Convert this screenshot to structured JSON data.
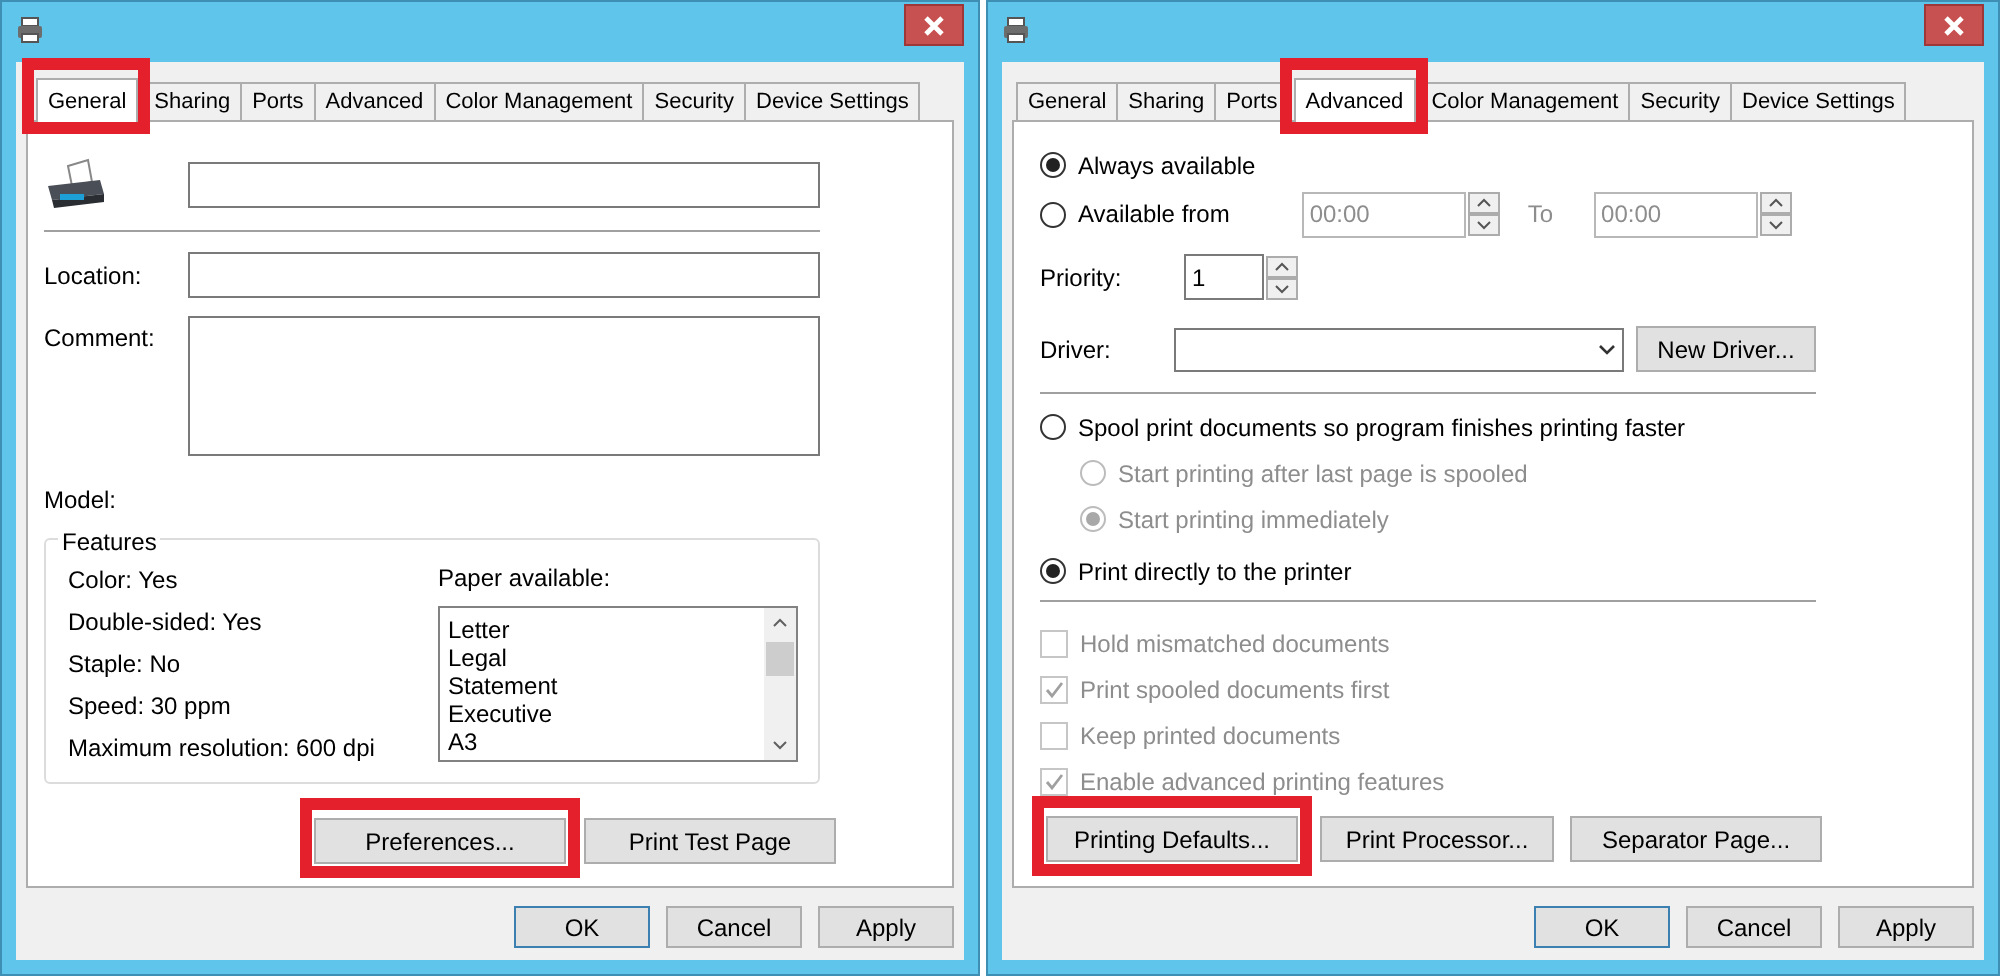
{
  "general_dialog": {
    "tabs": [
      {
        "label": "General",
        "selected": true,
        "highlighted": true
      },
      {
        "label": "Sharing",
        "selected": false,
        "highlighted": false
      },
      {
        "label": "Ports",
        "selected": false,
        "highlighted": false
      },
      {
        "label": "Advanced",
        "selected": false,
        "highlighted": false
      },
      {
        "label": "Color Management",
        "selected": false,
        "highlighted": false
      },
      {
        "label": "Security",
        "selected": false,
        "highlighted": false
      },
      {
        "label": "Device Settings",
        "selected": false,
        "highlighted": false
      }
    ],
    "location_label": "Location:",
    "comment_label": "Comment:",
    "model_label": "Model:",
    "features": {
      "title": "Features",
      "items": [
        "Color: Yes",
        "Double-sided: Yes",
        "Staple: No",
        "Speed: 30 ppm",
        "Maximum resolution: 600 dpi"
      ],
      "paper_label": "Paper available:",
      "paper": [
        "Letter",
        "Legal",
        "Statement",
        "Executive",
        "A3"
      ]
    },
    "buttons": [
      {
        "label": "Preferences...",
        "highlighted": true
      },
      {
        "label": "Print Test Page",
        "highlighted": false
      }
    ],
    "footer_buttons": [
      {
        "label": "OK",
        "default": true
      },
      {
        "label": "Cancel",
        "default": false
      },
      {
        "label": "Apply",
        "default": false
      }
    ]
  },
  "advanced_dialog": {
    "tabs": [
      {
        "label": "General",
        "selected": false,
        "highlighted": false
      },
      {
        "label": "Sharing",
        "selected": false,
        "highlighted": false
      },
      {
        "label": "Ports",
        "selected": false,
        "highlighted": false
      },
      {
        "label": "Advanced",
        "selected": true,
        "highlighted": true
      },
      {
        "label": "Color Management",
        "selected": false,
        "highlighted": false
      },
      {
        "label": "Security",
        "selected": false,
        "highlighted": false
      },
      {
        "label": "Device Settings",
        "selected": false,
        "highlighted": false
      }
    ],
    "availability": [
      {
        "label": "Always available",
        "selected": true
      },
      {
        "label": "Available from",
        "selected": false
      }
    ],
    "from_time": {
      "value": "00:00",
      "disabled": true
    },
    "to_label": "To",
    "to_time": {
      "value": "00:00",
      "disabled": true
    },
    "priority_label": "Priority:",
    "priority": "1",
    "driver_label": "Driver:",
    "new_driver_button": "New Driver...",
    "spool_options": [
      {
        "label": "Spool print documents so program finishes printing faster",
        "selected": false,
        "children": [
          {
            "label": "Start printing after last page is spooled",
            "selected": false,
            "disabled": true
          },
          {
            "label": "Start printing immediately",
            "selected": true,
            "disabled": true
          }
        ]
      },
      {
        "label": "Print directly to the printer",
        "selected": true
      }
    ],
    "checkboxes": [
      {
        "label": "Hold mismatched documents",
        "checked": false,
        "disabled": true
      },
      {
        "label": "Print spooled documents first",
        "checked": true,
        "disabled": true
      },
      {
        "label": "Keep printed documents",
        "checked": false,
        "disabled": true
      },
      {
        "label": "Enable advanced printing features",
        "checked": true,
        "disabled": true
      }
    ],
    "buttons": [
      {
        "label": "Printing Defaults...",
        "highlighted": true
      },
      {
        "label": "Print Processor...",
        "highlighted": false
      },
      {
        "label": "Separator Page...",
        "highlighted": false
      }
    ],
    "footer_buttons": [
      {
        "label": "OK",
        "default": true
      },
      {
        "label": "Cancel",
        "default": false
      },
      {
        "label": "Apply",
        "default": false
      }
    ]
  }
}
